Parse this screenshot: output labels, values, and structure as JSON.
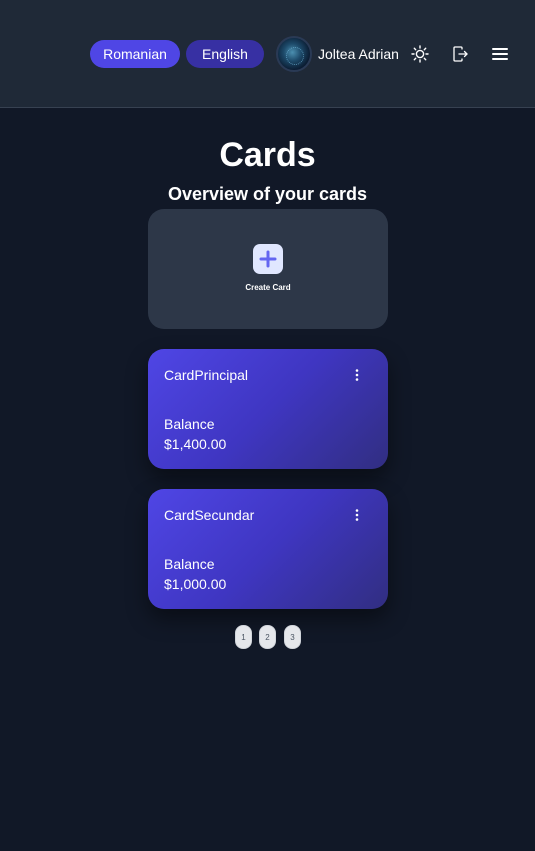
{
  "header": {
    "languages": [
      {
        "label": "Romanian",
        "active": true
      },
      {
        "label": "English",
        "active": false
      }
    ],
    "user": {
      "name": "Joltea Adrian"
    },
    "icons": [
      "sun-icon",
      "logout-icon",
      "menu-icon"
    ]
  },
  "main": {
    "title": "Cards",
    "subtitle": "Overview of your cards",
    "create_card_label": "Create Card",
    "cards": [
      {
        "name": "CardPrincipal",
        "balance_label": "Balance",
        "balance": "$1,400.00"
      },
      {
        "name": "CardSecundar",
        "balance_label": "Balance",
        "balance": "$1,000.00"
      }
    ],
    "pagination": [
      "1",
      "2",
      "3"
    ]
  },
  "colors": {
    "background": "#111827",
    "header": "#1f2937",
    "accent": "#4f46e5",
    "card_gradient_end": "#312e81",
    "create_card_bg": "#2d3748"
  }
}
